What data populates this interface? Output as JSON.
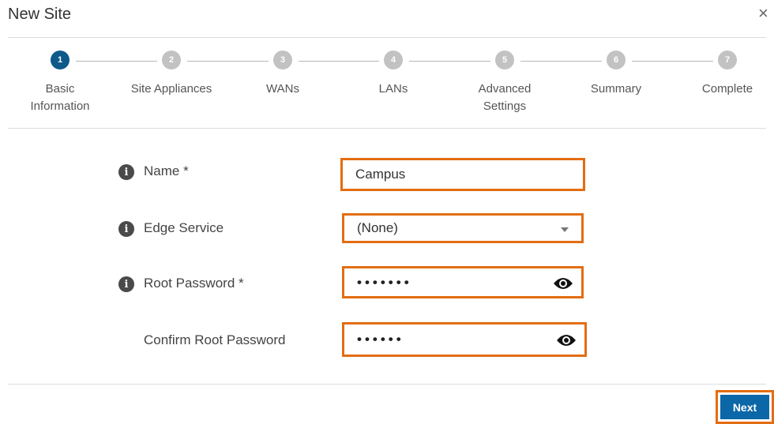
{
  "dialog": {
    "title": "New Site",
    "close_symbol": "×"
  },
  "steps": [
    {
      "number": "1",
      "label": "Basic\nInformation",
      "active": true
    },
    {
      "number": "2",
      "label": "Site Appliances",
      "active": false
    },
    {
      "number": "3",
      "label": "WANs",
      "active": false
    },
    {
      "number": "4",
      "label": "LANs",
      "active": false
    },
    {
      "number": "5",
      "label": "Advanced\nSettings",
      "active": false
    },
    {
      "number": "6",
      "label": "Summary",
      "active": false
    },
    {
      "number": "7",
      "label": "Complete",
      "active": false
    }
  ],
  "form": {
    "name": {
      "label": "Name *",
      "value": "Campus"
    },
    "edge_service": {
      "label": "Edge Service",
      "value": "(None)"
    },
    "root_password": {
      "label": "Root Password *",
      "masked": "•••••••"
    },
    "confirm_password": {
      "label": "Confirm Root Password",
      "masked": "••••••"
    }
  },
  "footer": {
    "next_label": "Next"
  },
  "colors": {
    "accent": "#0e5a8a",
    "highlight": "#e36d12",
    "button": "#0b67a8",
    "inactive_step": "#c2c2c2"
  }
}
